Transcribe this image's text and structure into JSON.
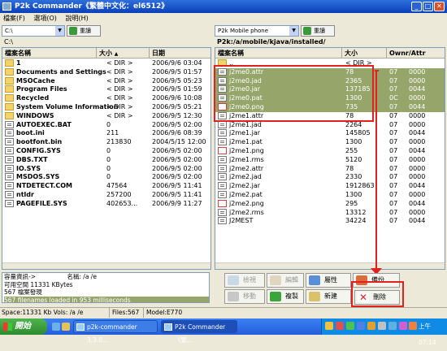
{
  "window": {
    "title": "P2k Commander《繁體中文化：el6512》",
    "min": "_",
    "max": "□",
    "close": "✕"
  },
  "menu": [
    "檔案(F)",
    "選項(O)",
    "說明(H)"
  ],
  "left": {
    "drive": "C:\\",
    "refresh": "重讀",
    "path": "C:\\",
    "headers": [
      "檔案名稱",
      "大小",
      "日期"
    ],
    "sort_indicator": "▲",
    "rows": [
      {
        "name": "1",
        "size": "< DIR >",
        "date": "2006/9/6 03:04",
        "icon": "folder"
      },
      {
        "name": "Documents and Settings",
        "size": "< DIR >",
        "date": "2006/9/5 01:57",
        "icon": "folder"
      },
      {
        "name": "MSOCache",
        "size": "< DIR >",
        "date": "2006/9/5 05:23",
        "icon": "folder"
      },
      {
        "name": "Program Files",
        "size": "< DIR >",
        "date": "2006/9/5 01:59",
        "icon": "folder"
      },
      {
        "name": "Recycled",
        "size": "< DIR >",
        "date": "2006/9/6 10:08",
        "icon": "folder"
      },
      {
        "name": "System Volume Information",
        "size": "< DIR >",
        "date": "2006/9/5 05:21",
        "icon": "folder"
      },
      {
        "name": "WINDOWS",
        "size": "< DIR >",
        "date": "2006/9/5 12:30",
        "icon": "folder"
      },
      {
        "name": "AUTOEXEC.BAT",
        "size": "0",
        "date": "2006/9/5 02:00",
        "icon": "file"
      },
      {
        "name": "boot.ini",
        "size": "211",
        "date": "2006/9/6 08:39",
        "icon": "file"
      },
      {
        "name": "bootfont.bin",
        "size": "213830",
        "date": "2004/5/15 12:00",
        "icon": "file"
      },
      {
        "name": "CONFIG.SYS",
        "size": "0",
        "date": "2006/9/5 02:00",
        "icon": "file"
      },
      {
        "name": "DBS.TXT",
        "size": "0",
        "date": "2006/9/5 02:00",
        "icon": "file"
      },
      {
        "name": "IO.SYS",
        "size": "0",
        "date": "2006/9/5 02:00",
        "icon": "file"
      },
      {
        "name": "MSDOS.SYS",
        "size": "0",
        "date": "2006/9/5 02:00",
        "icon": "file"
      },
      {
        "name": "NTDETECT.COM",
        "size": "47564",
        "date": "2006/9/5 11:41",
        "icon": "file"
      },
      {
        "name": "ntldr",
        "size": "257200",
        "date": "2006/9/5 11:41",
        "icon": "file"
      },
      {
        "name": "PAGEFILE.SYS",
        "size": "402653...",
        "date": "2006/9/9 11:27",
        "icon": "file"
      }
    ]
  },
  "right": {
    "drive": "P2k Mobile phone",
    "refresh": "重讀",
    "path": "P2k:/a/mobile/kjava/installed/",
    "headers": [
      "檔案名稱",
      "大小",
      "Ownr/Attr"
    ],
    "rows": [
      {
        "name": "..",
        "size": "< DIR >",
        "attr": "",
        "owner": "",
        "icon": "folder",
        "selected": false
      },
      {
        "name": "j2me0.attr",
        "size": "78",
        "attr": "0000",
        "owner": "07",
        "icon": "file",
        "selected": true
      },
      {
        "name": "j2me0.jad",
        "size": "2365",
        "attr": "0000",
        "owner": "07",
        "icon": "file",
        "selected": true
      },
      {
        "name": "j2me0.jar",
        "size": "137185",
        "attr": "0044",
        "owner": "07",
        "icon": "file",
        "selected": true
      },
      {
        "name": "j2me0.pat",
        "size": "1300",
        "attr": "0000",
        "owner": "0C",
        "icon": "file",
        "selected": true
      },
      {
        "name": "j2me0.png",
        "size": "735",
        "attr": "0044",
        "owner": "07",
        "icon": "png",
        "selected": true
      },
      {
        "name": "j2me1.attr",
        "size": "78",
        "attr": "0000",
        "owner": "07",
        "icon": "file",
        "selected": false
      },
      {
        "name": "j2me1.jad",
        "size": "2264",
        "attr": "0000",
        "owner": "07",
        "icon": "file",
        "selected": false
      },
      {
        "name": "j2me1.jar",
        "size": "145805",
        "attr": "0044",
        "owner": "07",
        "icon": "file",
        "selected": false
      },
      {
        "name": "j2me1.pat",
        "size": "1300",
        "attr": "0000",
        "owner": "07",
        "icon": "file",
        "selected": false
      },
      {
        "name": "j2me1.png",
        "size": "255",
        "attr": "0044",
        "owner": "07",
        "icon": "png",
        "selected": false
      },
      {
        "name": "j2me1.rms",
        "size": "5120",
        "attr": "0000",
        "owner": "07",
        "icon": "file",
        "selected": false
      },
      {
        "name": "j2me2.attr",
        "size": "78",
        "attr": "0000",
        "owner": "07",
        "icon": "file",
        "selected": false
      },
      {
        "name": "j2me2.jad",
        "size": "2330",
        "attr": "0000",
        "owner": "07",
        "icon": "file",
        "selected": false
      },
      {
        "name": "j2me2.jar",
        "size": "1912863",
        "attr": "0044",
        "owner": "07",
        "icon": "file",
        "selected": false
      },
      {
        "name": "j2me2.pat",
        "size": "1300",
        "attr": "0000",
        "owner": "07",
        "icon": "file",
        "selected": false
      },
      {
        "name": "j2me2.png",
        "size": "295",
        "attr": "0044",
        "owner": "07",
        "icon": "png",
        "selected": false
      },
      {
        "name": "j2me2.rms",
        "size": "13312",
        "attr": "0000",
        "owner": "07",
        "icon": "file",
        "selected": false
      },
      {
        "name": "J2MEST",
        "size": "34224",
        "attr": "0044",
        "owner": "07",
        "icon": "file",
        "selected": false
      }
    ]
  },
  "info": {
    "lines": [
      "容量資訊->",
      "可用空間  11331 KBytes",
      "567 檔案發現",
      "567 filenames loaded in 953 milliseconds"
    ],
    "name_label": "名稱: /a /e"
  },
  "actions": {
    "view": "檢視",
    "edit": "編輯",
    "attributes": "屬性",
    "backup": "備份",
    "move": "移動",
    "copy": "複製",
    "new": "新建",
    "delete": "刪除"
  },
  "status": {
    "space": "Space:11331 Kb  Vols: /a /e",
    "files": "Files:567",
    "model": "Model:E770"
  },
  "taskbar": {
    "start": "開始",
    "tasks": [
      "p2k-commander 3.3.0...",
      "P2k Commander《繁..."
    ],
    "clock": "上午 07:14"
  },
  "colors": {
    "selection": "#96a56a",
    "annotation": "#e32020",
    "title": "#0a3fb8"
  }
}
